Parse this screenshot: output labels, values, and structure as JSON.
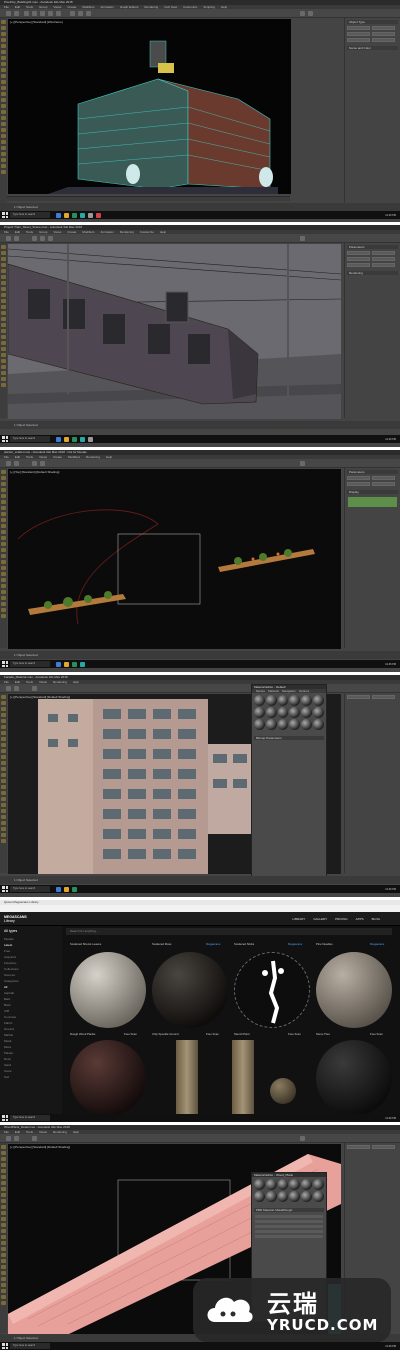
{
  "screens": [
    {
      "title": "PixelCity_Building01.max - Autodesk 3ds Max 2018",
      "menu": [
        "File",
        "Edit",
        "Tools",
        "Group",
        "Views",
        "Create",
        "Modifiers",
        "Animation",
        "Graph Editors",
        "Rendering",
        "Civil View",
        "Customize",
        "Scripting",
        "Help"
      ],
      "viewport_label": "[+] [Perspective] [Standard] [Wireframe]",
      "panel_header": "Object Type",
      "panel_header2": "Name and Color",
      "status": "1 Object Selected",
      "prompt": "Click or click-and-drag to select objects"
    },
    {
      "title": "Project Tram_Street_Scene.max - Autodesk 3ds Max 2018",
      "viewport_label": "[+] [Camera001] [Standard] [Default Shading]",
      "panel_header": "Parameters",
      "panel_header2": "Rendering",
      "status": "1 Object Selected"
    },
    {
      "title": "planter_scatter.max - Autodesk 3ds Max 2018 - Not for Resale",
      "viewport_label": "[+] [Top] [Standard] [Default Shading]",
      "panel_header": "Parameters",
      "panel_header2": "Display",
      "status": "1 Object Selected"
    },
    {
      "title": "Facade_Material.max - Autodesk 3ds Max 2018",
      "viewport_label": "[+] [Perspective] [Standard] [Default Shading]",
      "matwin_title": "Material Editor - Default",
      "matwin_menu": [
        "Modes",
        "Material",
        "Navigation",
        "Options",
        "Utilities"
      ],
      "mat_section": "Bitmap Parameters",
      "status": "1 Object Selected"
    },
    {
      "title": "Quixel Megascans Library",
      "logo_line1": "MEGASCANS",
      "logo_line2": "Library",
      "nav": [
        "LIBRARY",
        "GALLERY",
        "PRICING",
        "APPS",
        "BLOG"
      ],
      "search_placeholder": "Search for anything...",
      "filter_label": "All types",
      "side": [
        "Models",
        "Latest",
        "Free",
        "Acquired",
        "Favorites",
        "Collections",
        "Sources",
        "",
        "Categories",
        "All",
        "Asphalt",
        "Bark",
        "Brick",
        "Cliff",
        "Concrete",
        "Fabric",
        "Ground",
        "Marble",
        "Metal",
        "Moss",
        "Plaster",
        "Rock",
        "Sand",
        "Snow",
        "Soil",
        "Stone",
        "Tile",
        "Wood"
      ],
      "cards_row1": [
        {
          "name": "Scattered Shoots Leaves",
          "tag": ""
        },
        {
          "name": "Scattered Moss",
          "tag": "Megascans"
        },
        {
          "name": "Scattered Sticks",
          "tag": "Megascans"
        },
        {
          "name": "Pine Needles",
          "tag": "Megascans"
        }
      ],
      "cards_row2": [
        {
          "name": "Rough Wood Planks",
          "tag": "Free Scan"
        },
        {
          "name": "Chip Speckle Ground",
          "tag": "Free Scan"
        },
        {
          "name": "Stencil Paint",
          "tag": "Free Scan"
        },
        {
          "name": "Stone Tiles",
          "tag": "Free Scan"
        }
      ]
    },
    {
      "title": "WoodPlank_Detail.max - Autodesk 3ds Max 2018",
      "viewport_label": "[+] [Perspective] [Standard] [Default Shading]",
      "matwin_title": "Material Editor - Wood_Plank",
      "mat_section": "PBR Material: Metal/Rough",
      "status": "1 Object Selected"
    }
  ],
  "taskbar": {
    "search_placeholder": "Type here to search",
    "clock": "12:46 PM"
  },
  "watermark": {
    "cn": "云瑞",
    "en": "YRUCD.COM"
  }
}
